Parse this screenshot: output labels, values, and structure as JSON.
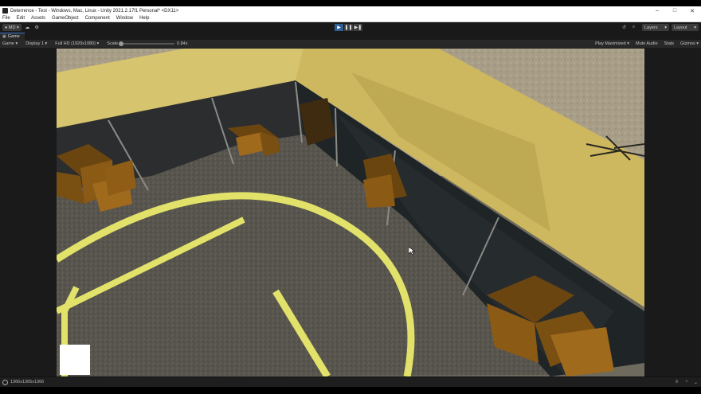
{
  "window": {
    "title": "Deterrence - Test - Windows, Mac, Linux - Unity 2021.2.17f1 Personal* <DX11>",
    "controls": {
      "minimize": "–",
      "maximize": "□",
      "close": "✕"
    }
  },
  "menu": [
    "File",
    "Edit",
    "Assets",
    "GameObject",
    "Component",
    "Window",
    "Help"
  ],
  "toolbar": {
    "account_label": "MD",
    "account_icon": "user-icon",
    "cloud_icon": "cloud-icon",
    "collab_icon": "collab-icon",
    "play_icon": "▶",
    "pause_icon": "❚❚",
    "step_icon": "▶❚",
    "history_icon": "history-icon",
    "search_icon": "search-icon",
    "layers_label": "Layers",
    "layout_label": "Layout"
  },
  "tabs": [
    {
      "label": "Game",
      "icon": "game-icon"
    }
  ],
  "game_view": {
    "mode_label": "Game",
    "display_label": "Display 1",
    "resolution_label": "Full HD (1920x1080)",
    "scale_label": "Scale",
    "scale_value": "0.84x",
    "play_maximized": "Play Maximized",
    "mute_audio": "Mute Audio",
    "stats": "Stats",
    "gizmos": "Gizmos"
  },
  "status": {
    "text": "1366x1365x1366",
    "icons": [
      "status-icon",
      "console-icon",
      "bell-icon",
      "collapse-icon"
    ]
  },
  "colors": {
    "play_active": "#2e5c95",
    "tab_accent": "#3d7bd5",
    "editor_dark": "#191919",
    "panel": "#282828",
    "tent_yellow": "#d9c36a",
    "floor_gray": "#5a5750",
    "line_yellow": "#e2e26a",
    "crate_orange": "#8b5a14"
  }
}
